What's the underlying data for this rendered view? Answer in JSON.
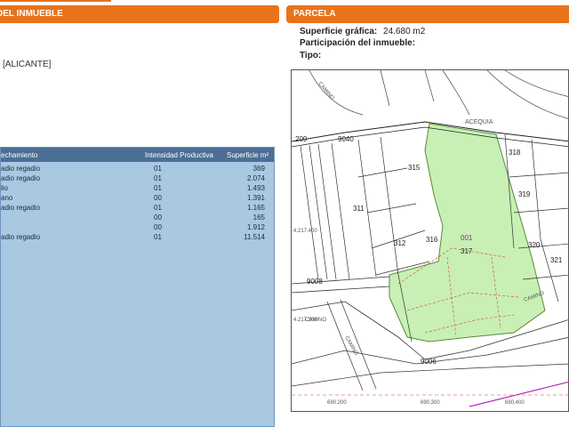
{
  "left_panel": {
    "header": "DEL INMUEBLE",
    "location": "[ALICANTE]",
    "table": {
      "columns": [
        "echamiento",
        "Intensidad Productiva",
        "Superficie m²"
      ],
      "rows": [
        {
          "c1": "adio regadio",
          "c2": "01",
          "c3": "369"
        },
        {
          "c1": "adio regadio",
          "c2": "01",
          "c3": "2.074"
        },
        {
          "c1": "lio",
          "c2": "01",
          "c3": "1.493"
        },
        {
          "c1": "ano",
          "c2": "00",
          "c3": "1.391"
        },
        {
          "c1": "adio regadio",
          "c2": "01",
          "c3": "1.165"
        },
        {
          "c1": "",
          "c2": "00",
          "c3": "165"
        },
        {
          "c1": "",
          "c2": "00",
          "c3": "1.912"
        },
        {
          "c1": "adio regadio",
          "c2": "01",
          "c3": "11.514"
        }
      ]
    }
  },
  "right_panel": {
    "header": "PARCELA",
    "superficie_label": "Superficie gráfica:",
    "superficie_value": "24.680 m2",
    "participacion_label": "Participación del inmueble:",
    "tipo_label": "Tipo:",
    "map": {
      "parcel_numbers": [
        "315",
        "318",
        "319",
        "311",
        "312",
        "316",
        "317",
        "320",
        "321",
        "001"
      ],
      "codes": [
        "9040",
        "9006",
        "9008",
        "209"
      ],
      "road_labels": [
        "ACEQUIA",
        "CAMINO",
        "CAMINO",
        "CAMINO",
        "CAMINO"
      ],
      "coords": [
        "4.217.400",
        "4.217.300",
        "690.200",
        "690.300",
        "690.400"
      ]
    }
  },
  "colors": {
    "accent": "#e8731b",
    "table_bg": "#a9c8e2",
    "table_header": "#4c6f95",
    "parcel_fill": "#c8f0b4"
  }
}
